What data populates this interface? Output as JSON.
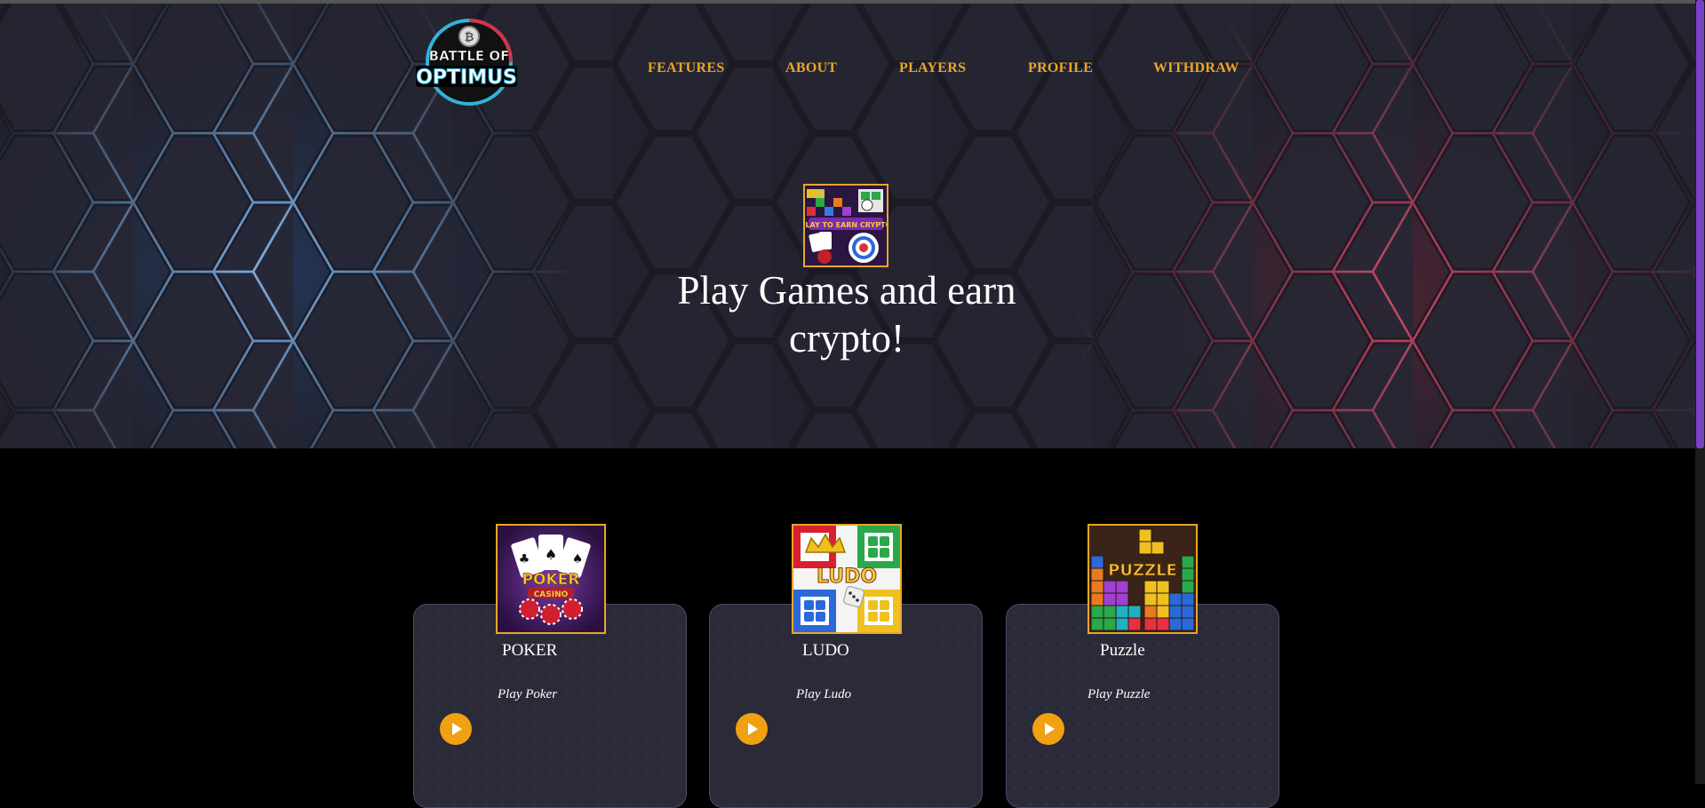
{
  "logo": {
    "line1": "BATTLE OF",
    "line2": "OPTIMUS",
    "coin_symbol": "₿"
  },
  "nav": {
    "items": [
      {
        "label": "FEATURES"
      },
      {
        "label": "ABOUT"
      },
      {
        "label": "PLAYERS"
      },
      {
        "label": "PROFILE"
      },
      {
        "label": "WITHDRAW"
      }
    ]
  },
  "hero": {
    "banner_text": "PLAY TO EARN CRYPTO",
    "title": "Play Games and earn crypto!"
  },
  "games": [
    {
      "title": "POKER",
      "subtitle": "Play Poker",
      "thumb_text": "POKER",
      "thumb_subtext": "CASINO"
    },
    {
      "title": "LUDO",
      "subtitle": "Play Ludo",
      "thumb_text": "LUDO"
    },
    {
      "title": "Puzzle",
      "subtitle": "Play Puzzle",
      "thumb_text": "PUZZLE"
    }
  ],
  "colors": {
    "accent": "#e9a52a",
    "play_button": "#f0a010",
    "hero_bg": "#22222e",
    "card_bg": "#2a2a38",
    "scroll_thumb": "#7a3fc8"
  }
}
